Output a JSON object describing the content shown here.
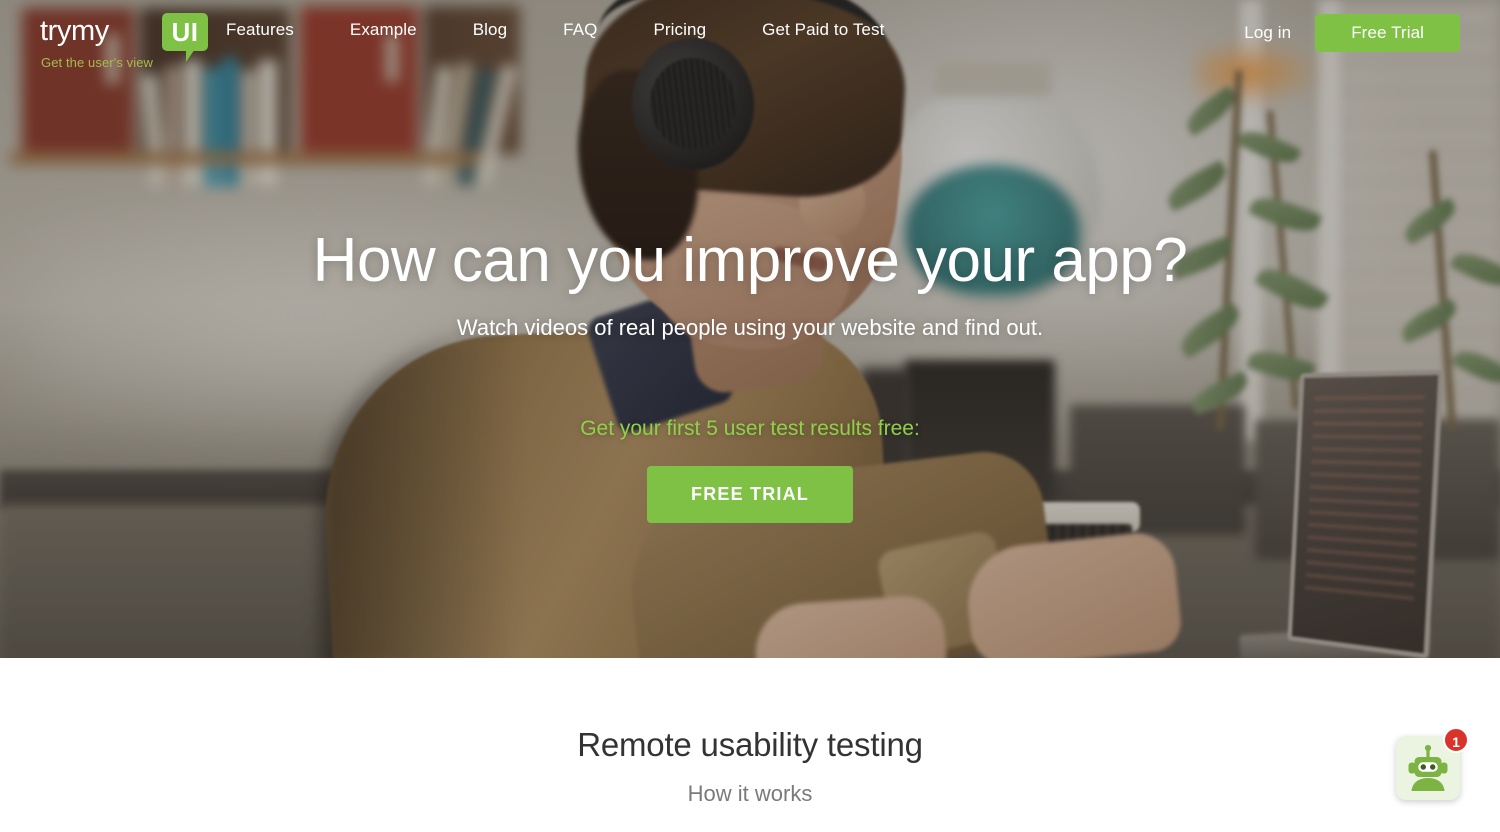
{
  "brand": {
    "logo_text": "trymy",
    "logo_badge": "UI",
    "tagline": "Get the user's view",
    "accent_green": "#7ec144",
    "accent_green_text": "#8fd14a",
    "tagline_color": "#a9bb4e",
    "badge_red": "#d9342b"
  },
  "nav": {
    "links": [
      {
        "label": "Features"
      },
      {
        "label": "Example"
      },
      {
        "label": "Blog"
      },
      {
        "label": "FAQ"
      },
      {
        "label": "Pricing"
      },
      {
        "label": "Get Paid to Test"
      }
    ],
    "login_label": "Log in",
    "trial_button_label": "Free Trial"
  },
  "hero": {
    "headline": "How can you improve your app?",
    "subheadline": "Watch videos of real people using your website and find out.",
    "offer_text": "Get your first 5 user test results free:",
    "cta_label": "FREE TRIAL"
  },
  "section": {
    "title": "Remote usability testing",
    "subtitle": "How it works"
  },
  "chat_widget": {
    "icon": "robot-icon",
    "unread_count": "1"
  }
}
